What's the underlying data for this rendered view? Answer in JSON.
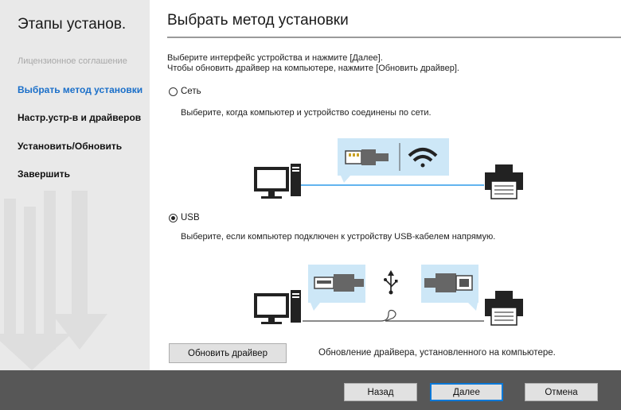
{
  "sidebar": {
    "title": "Этапы установ.",
    "steps": [
      {
        "label": "Лицензионное соглашение",
        "state": "done"
      },
      {
        "label": "Выбрать метод установки",
        "state": "active"
      },
      {
        "label": "Настр.устр-в и драйверов",
        "state": "pending"
      },
      {
        "label": "Установить/Обновить",
        "state": "pending"
      },
      {
        "label": "Завершить",
        "state": "pending"
      }
    ]
  },
  "main": {
    "title": "Выбрать метод установки",
    "instruction_line1": "Выберите интерфейс устройства и нажмите [Далее].",
    "instruction_line2": "Чтобы обновить драйвер на компьютере, нажмите [Обновить драйвер].",
    "options": [
      {
        "label": "Сеть",
        "selected": false,
        "description": "Выберите, когда компьютер и устройство соединены по сети."
      },
      {
        "label": "USB",
        "selected": true,
        "description": "Выберите, если компьютер подключен к устройству USB-кабелем напрямую."
      }
    ],
    "update_button": "Обновить драйвер",
    "update_note": "Обновление драйвера, установленного на компьютере."
  },
  "footer": {
    "back": "Назад",
    "next": "Далее",
    "cancel": "Отмена"
  },
  "colors": {
    "accent": "#1a6fc9",
    "sidebar_bg": "#e9e9e9",
    "footer_bg": "#575757",
    "bubble_bg": "#cde7f7",
    "line_blue": "#2f9bea"
  },
  "icons": [
    "computer-icon",
    "printer-icon",
    "ethernet-cable-icon",
    "wifi-icon",
    "usb-a-plug-icon",
    "usb-b-plug-icon",
    "usb-symbol-icon"
  ]
}
